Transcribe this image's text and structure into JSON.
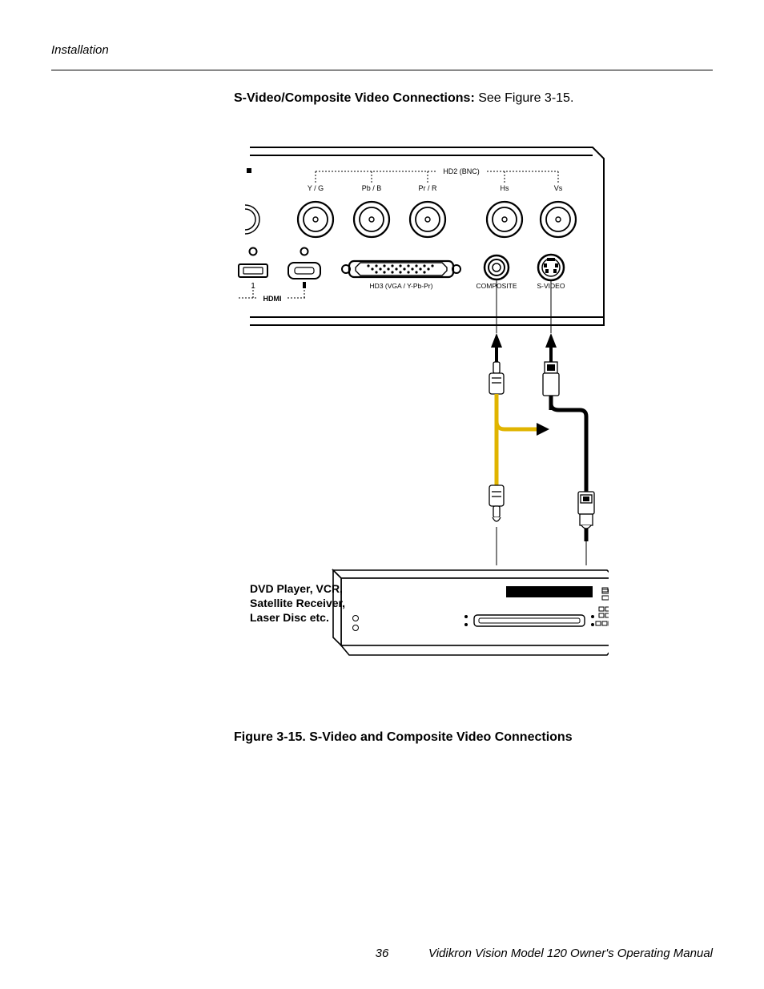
{
  "header": {
    "section": "Installation"
  },
  "para": {
    "lead": "S-Video/Composite Video Connections: ",
    "rest": "See Figure 3-15."
  },
  "diagram": {
    "hd2_group": "HD2 (BNC)",
    "bnc_labels": [
      "Y / G",
      "Pb / B",
      "Pr / R",
      "Hs",
      "Vs"
    ],
    "hdmi_group": "HDMI",
    "hd3": "HD3 (VGA / Y-Pb-Pr)",
    "composite": "COMPOSITE",
    "svideo": "S-VIDEO",
    "source_box": "DVD Player, VCR,\nSatellite Receiver,\nLaser Disc etc."
  },
  "caption": "Figure 3-15. S-Video and Composite Video Connections",
  "footer": {
    "page_no": "36",
    "right": "Vidikron Vision Model 120 Owner's Operating Manual"
  }
}
